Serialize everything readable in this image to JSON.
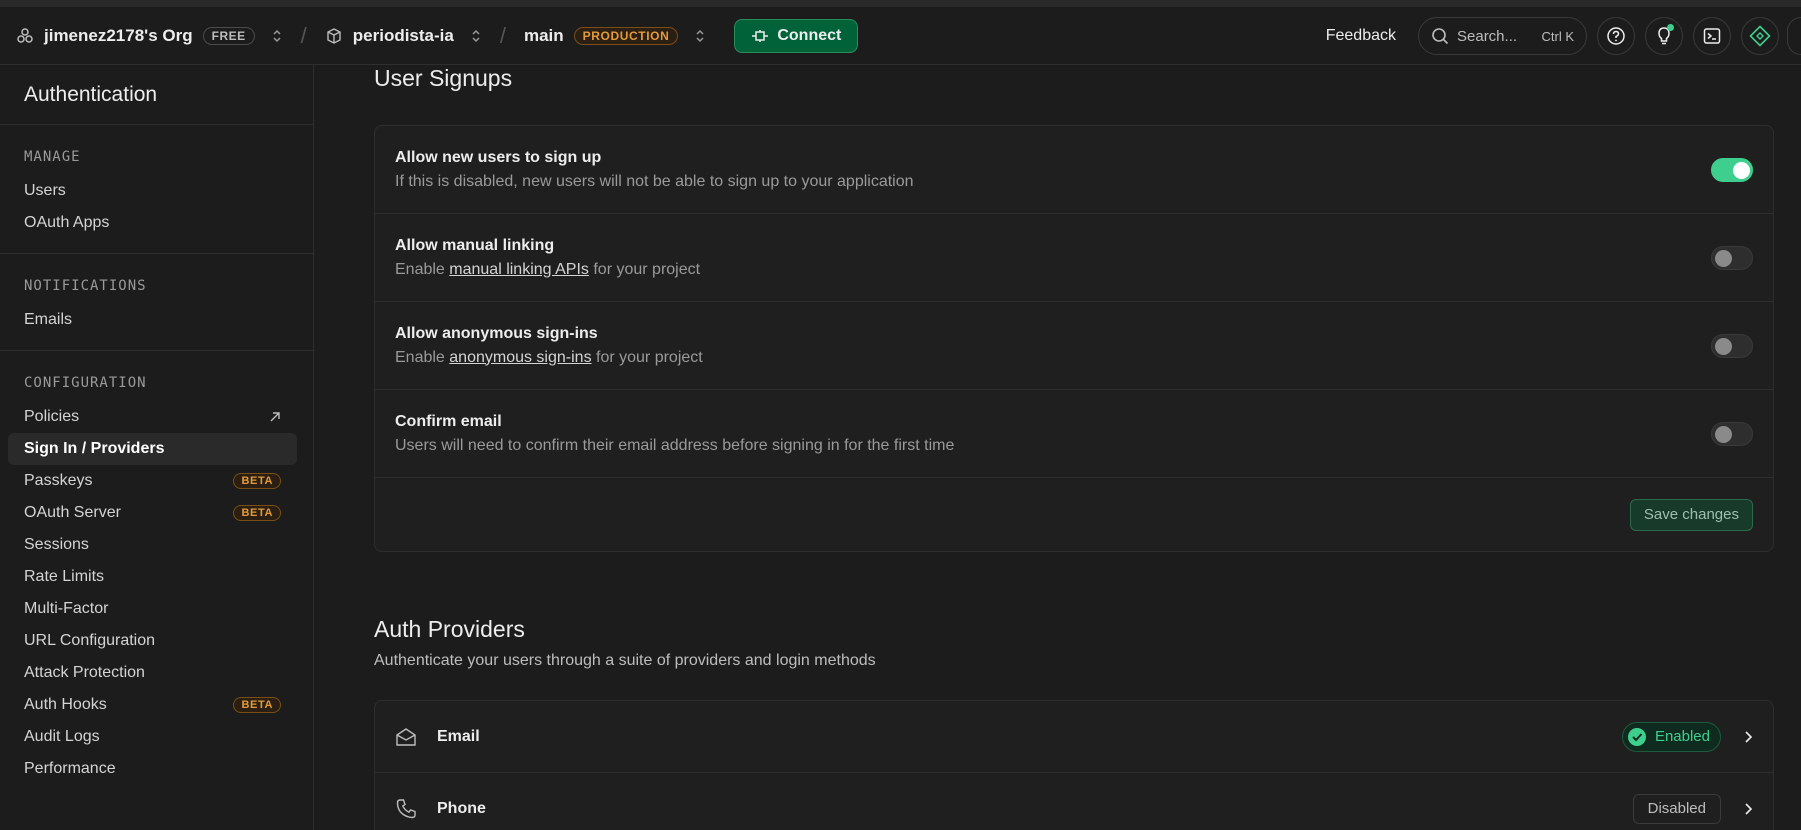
{
  "topbar": {
    "org_name": "jimenez2178's Org",
    "org_badge": "FREE",
    "project_name": "periodista-ia",
    "branch_name": "main",
    "branch_badge": "PRODUCTION",
    "connect_label": "Connect",
    "feedback_label": "Feedback",
    "search_placeholder": "Search...",
    "search_shortcut": "Ctrl K"
  },
  "sidebar": {
    "title": "Authentication",
    "sections": [
      {
        "heading": "MANAGE",
        "items": [
          {
            "label": "Users"
          },
          {
            "label": "OAuth Apps"
          }
        ]
      },
      {
        "heading": "NOTIFICATIONS",
        "items": [
          {
            "label": "Emails"
          }
        ]
      },
      {
        "heading": "CONFIGURATION",
        "items": [
          {
            "label": "Policies",
            "external": true
          },
          {
            "label": "Sign In / Providers",
            "active": true
          },
          {
            "label": "Passkeys",
            "badge": "BETA"
          },
          {
            "label": "OAuth Server",
            "badge": "BETA"
          },
          {
            "label": "Sessions"
          },
          {
            "label": "Rate Limits"
          },
          {
            "label": "Multi-Factor"
          },
          {
            "label": "URL Configuration"
          },
          {
            "label": "Attack Protection"
          },
          {
            "label": "Auth Hooks",
            "badge": "BETA"
          },
          {
            "label": "Audit Logs"
          },
          {
            "label": "Performance"
          }
        ]
      }
    ]
  },
  "user_signups": {
    "title": "User Signups",
    "rows": [
      {
        "title": "Allow new users to sign up",
        "desc_pre": "If this is disabled, new users will not be able to sign up to your application",
        "link": "",
        "desc_post": "",
        "enabled": true
      },
      {
        "title": "Allow manual linking",
        "desc_pre": "Enable ",
        "link": "manual linking APIs",
        "desc_post": " for your project",
        "enabled": false
      },
      {
        "title": "Allow anonymous sign-ins",
        "desc_pre": "Enable ",
        "link": "anonymous sign-ins",
        "desc_post": " for your project",
        "enabled": false
      },
      {
        "title": "Confirm email",
        "desc_pre": "Users will need to confirm their email address before signing in for the first time",
        "link": "",
        "desc_post": "",
        "enabled": false
      }
    ],
    "save_label": "Save changes"
  },
  "auth_providers": {
    "title": "Auth Providers",
    "subtitle": "Authenticate your users through a suite of providers and login methods",
    "providers": [
      {
        "name": "Email",
        "icon": "mail-icon",
        "status": "Enabled"
      },
      {
        "name": "Phone",
        "icon": "phone-icon",
        "status": "Disabled"
      }
    ]
  },
  "colors": {
    "accent": "#3ecf8e",
    "connect": "#006239",
    "beta": "#e59a3a",
    "background": "#1c1c1c"
  }
}
